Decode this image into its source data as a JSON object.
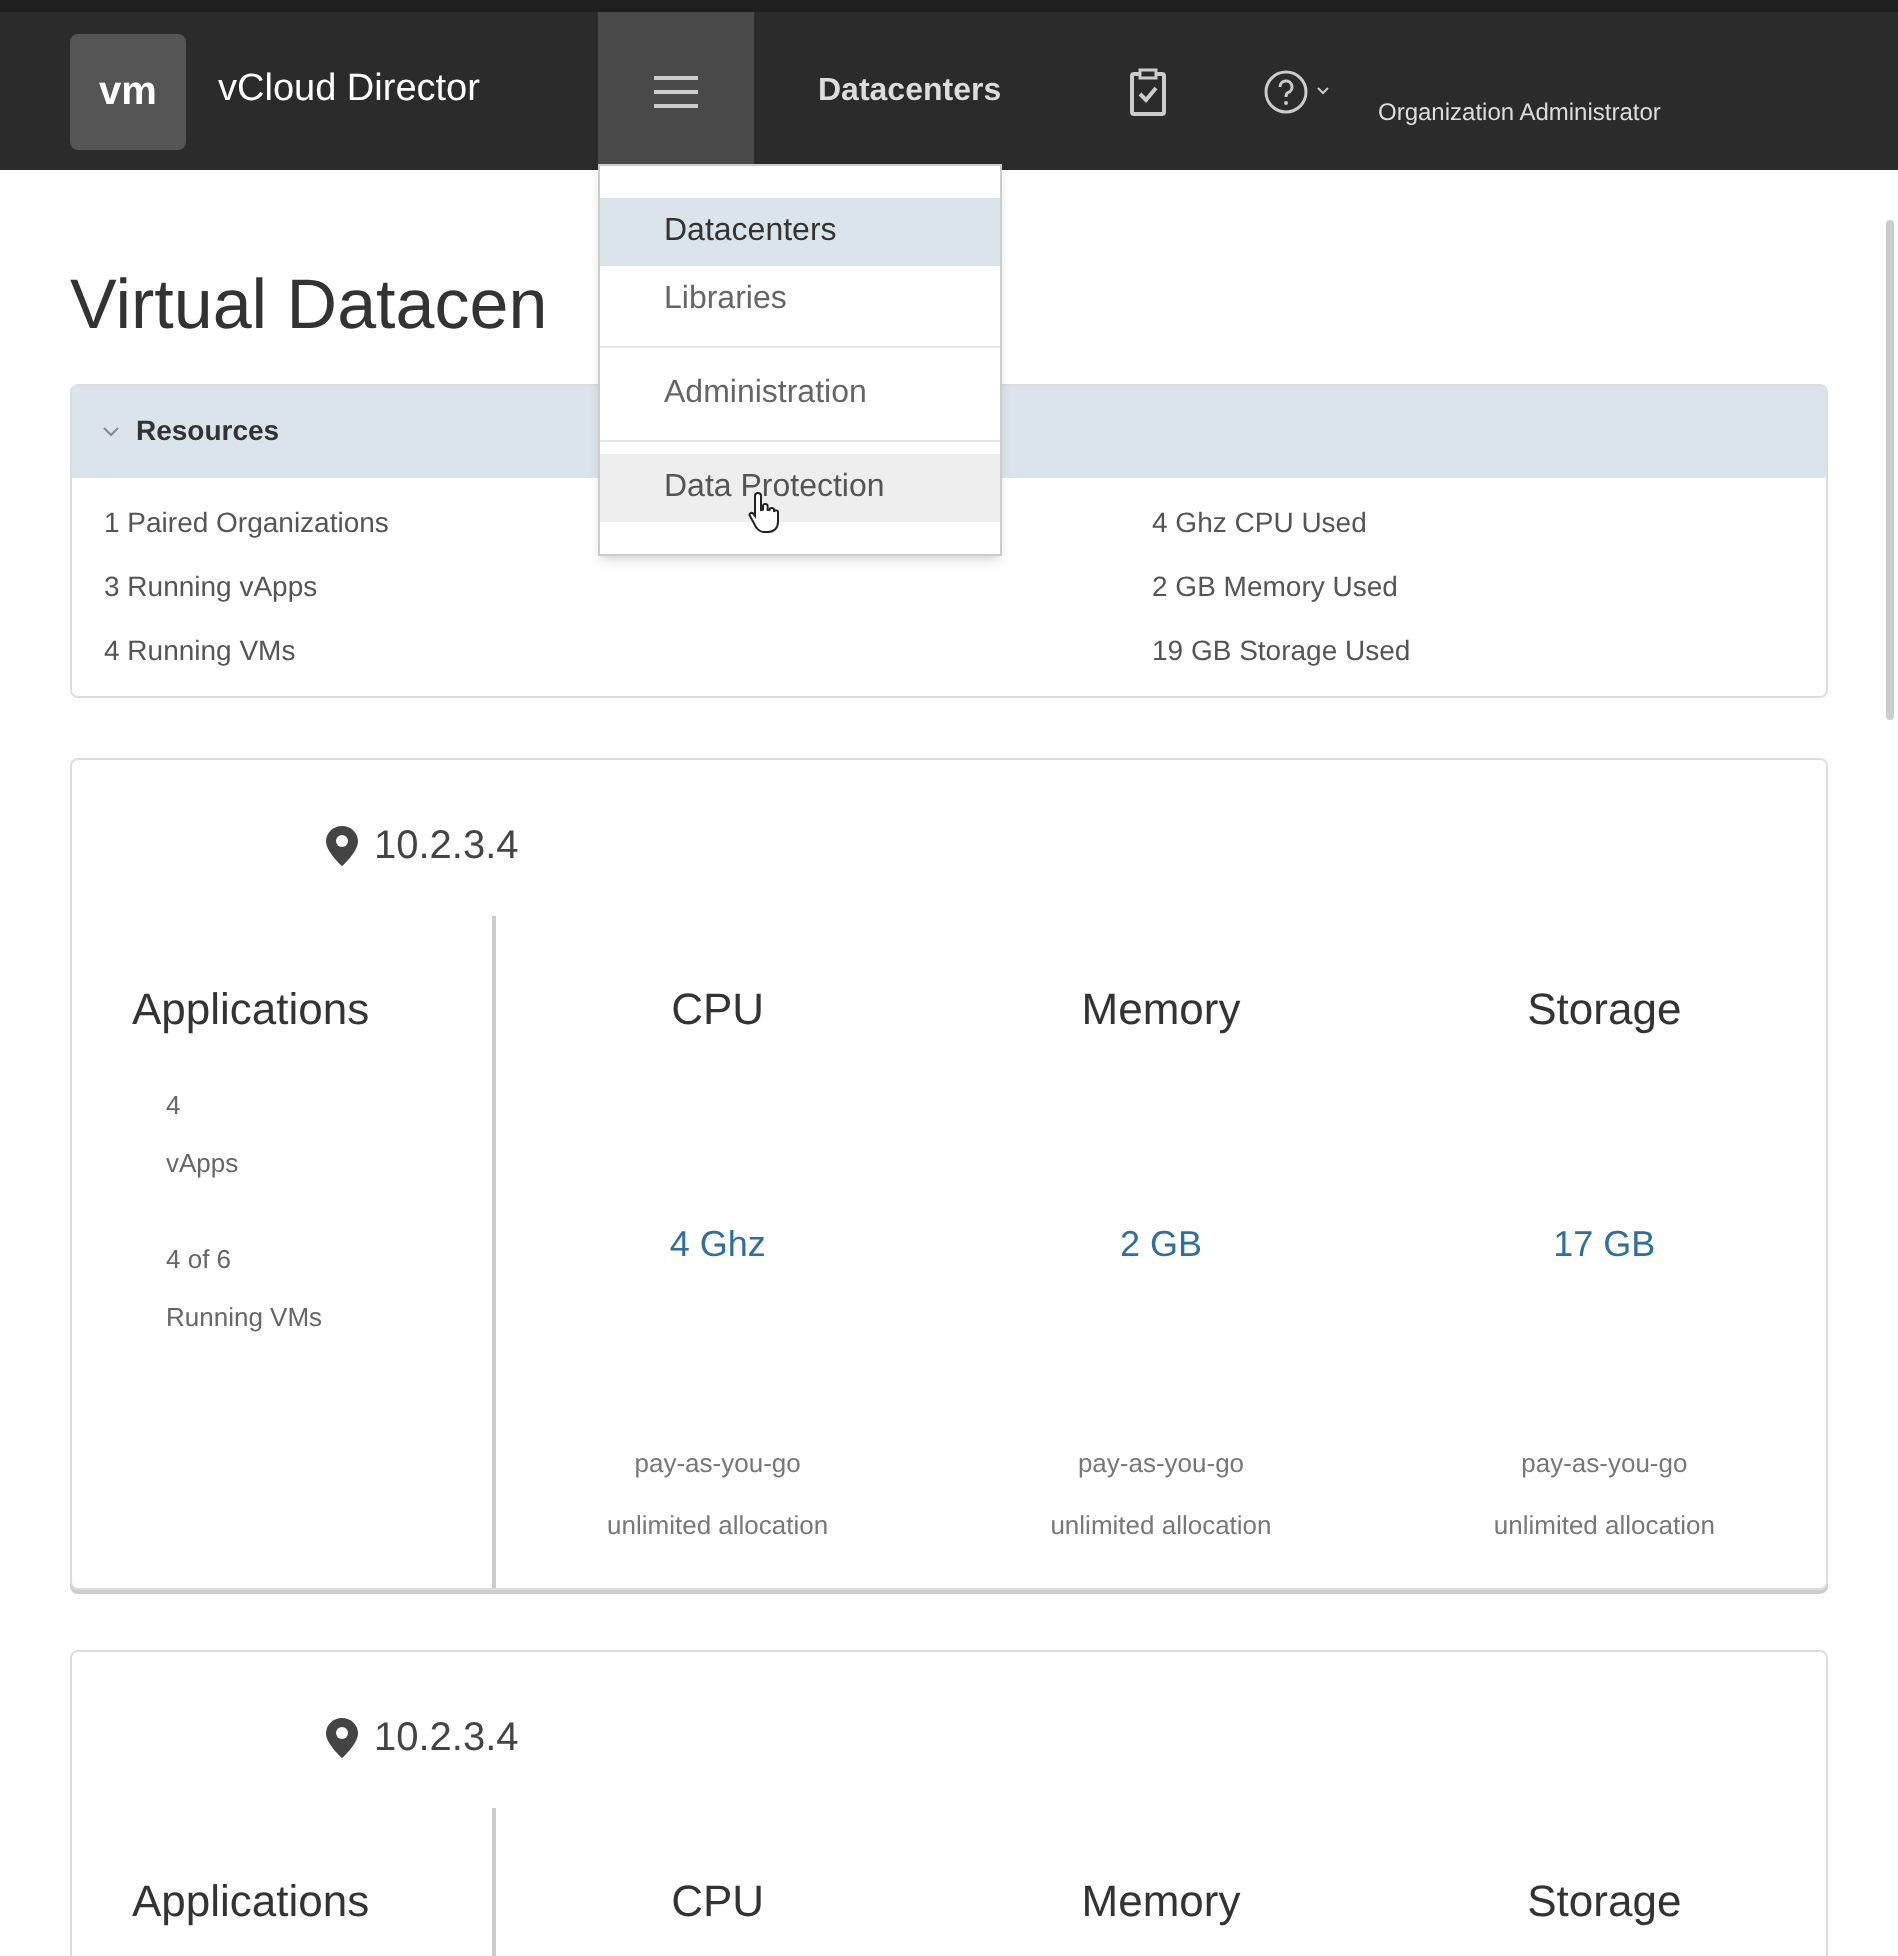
{
  "header": {
    "logo": "vm",
    "product": "vCloud Director",
    "nav_label": "Datacenters",
    "user": "Organization Administrator"
  },
  "menu": {
    "items": [
      {
        "label": "Datacenters",
        "selected": true,
        "hovered": false
      },
      {
        "label": "Libraries",
        "selected": false,
        "hovered": false
      },
      {
        "label": "Administration",
        "selected": false,
        "hovered": false
      },
      {
        "label": "Data Protection",
        "selected": false,
        "hovered": true
      }
    ]
  },
  "title": "Virtual Datacen",
  "resources": {
    "heading": "Resources",
    "expanded": true,
    "left": [
      "1 Paired Organizations",
      "3 Running vApps",
      "4 Running VMs"
    ],
    "right": [
      "4 Ghz CPU Used",
      "2 GB Memory Used",
      "19 GB Storage Used"
    ]
  },
  "datacenters": [
    {
      "location": "10.2.3.4",
      "applications": {
        "heading": "Applications",
        "stats": [
          {
            "value": "4",
            "label": "vApps"
          },
          {
            "value": "4 of 6",
            "label": "Running VMs"
          }
        ]
      },
      "metrics": [
        {
          "heading": "CPU",
          "value": "4 Ghz",
          "notes": [
            "pay-as-you-go",
            "unlimited allocation"
          ]
        },
        {
          "heading": "Memory",
          "value": "2 GB",
          "notes": [
            "pay-as-you-go",
            "unlimited allocation"
          ]
        },
        {
          "heading": "Storage",
          "value": "17 GB",
          "notes": [
            "pay-as-you-go",
            "unlimited allocation"
          ]
        }
      ]
    },
    {
      "location": "10.2.3.4",
      "applications": {
        "heading": "Applications"
      },
      "metrics": [
        {
          "heading": "CPU"
        },
        {
          "heading": "Memory"
        },
        {
          "heading": "Storage"
        }
      ]
    }
  ]
}
